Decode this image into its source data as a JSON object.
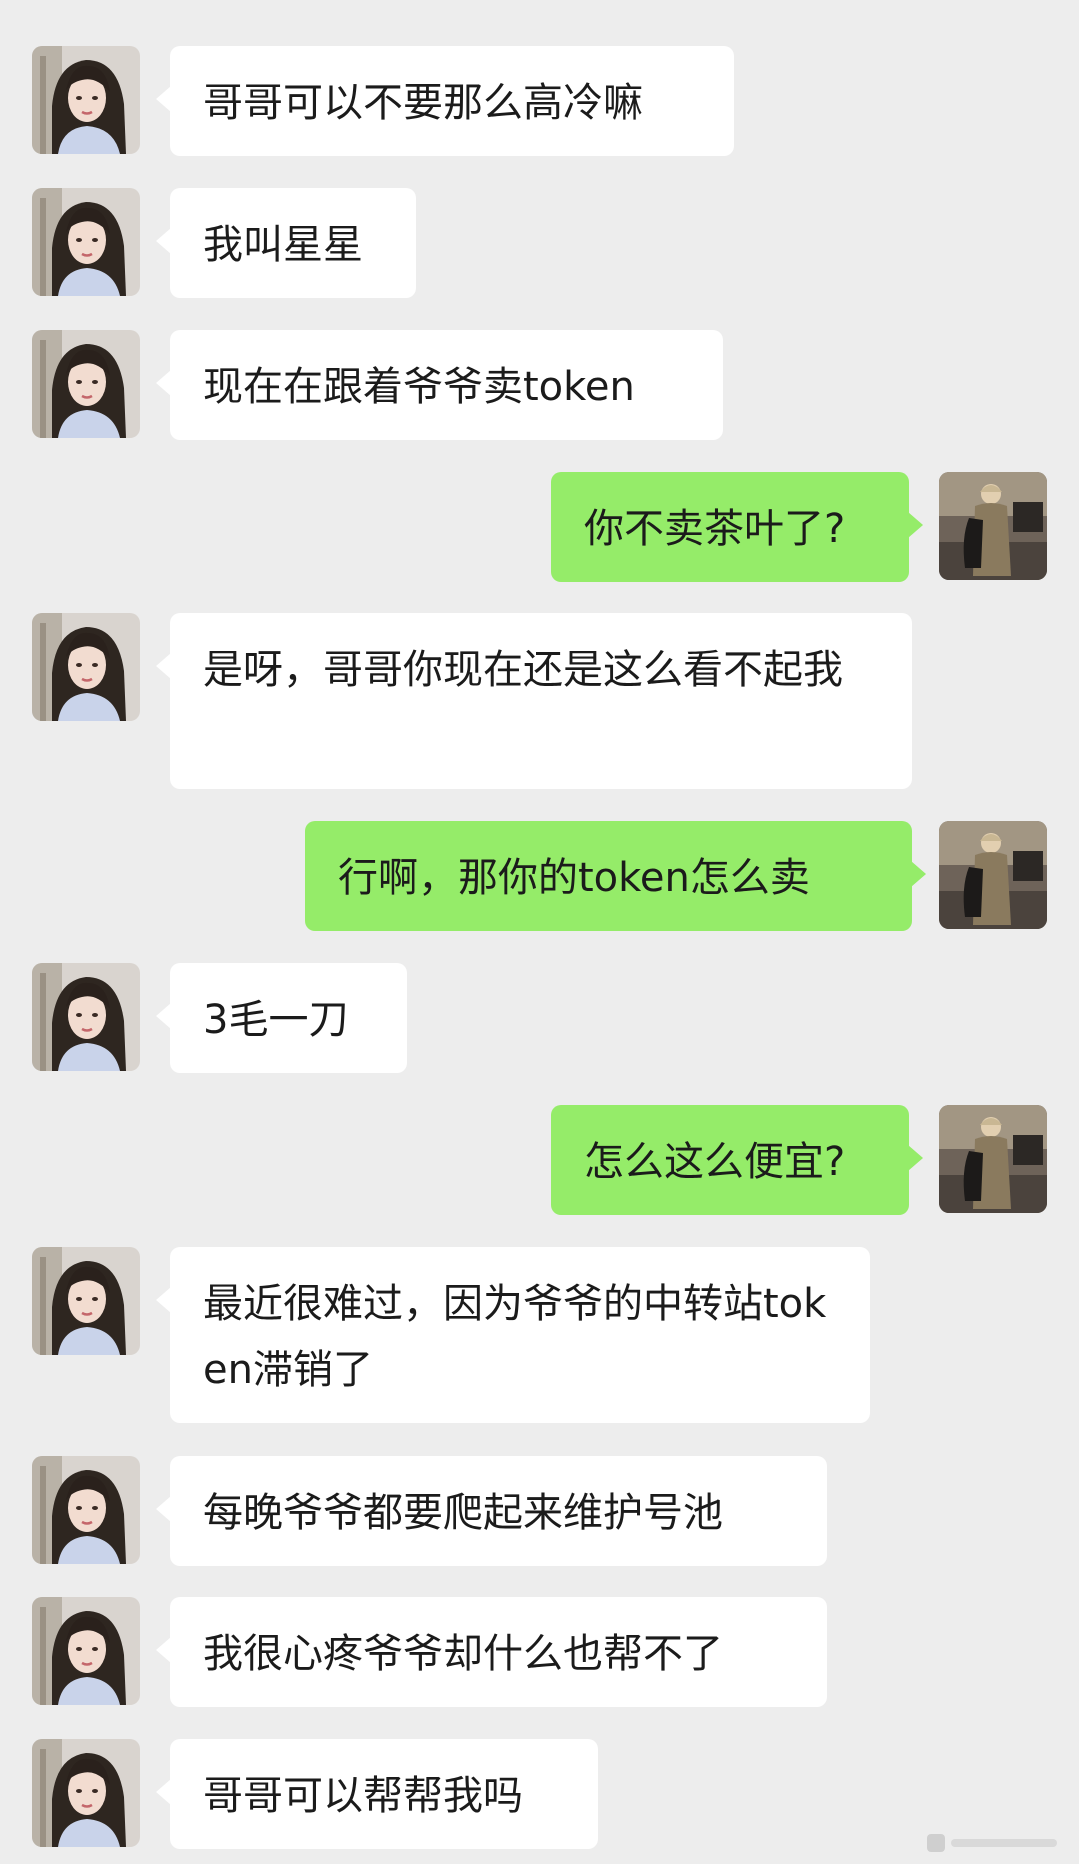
{
  "colors": {
    "background": "#ededed",
    "incoming_bubble": "#ffffff",
    "outgoing_bubble": "#95ec69",
    "text": "#1b1b1b"
  },
  "avatars": {
    "left_icon": "girl-avatar-icon",
    "right_icon": "man-photo-avatar-icon"
  },
  "messages": [
    {
      "side": "left",
      "text": "哥哥可以不要那么高冷嘛"
    },
    {
      "side": "left",
      "text": "我叫星星"
    },
    {
      "side": "left",
      "text": "现在在跟着爷爷卖token"
    },
    {
      "side": "right",
      "text": "你不卖茶叶了?"
    },
    {
      "side": "left",
      "text": "是呀，哥哥你现在还是这么看不起我"
    },
    {
      "side": "right",
      "text": "行啊，那你的token怎么卖"
    },
    {
      "side": "left",
      "text": "3毛一刀"
    },
    {
      "side": "right",
      "text": "怎么这么便宜?"
    },
    {
      "side": "left",
      "text": "最近很难过，因为爷爷的中转站token滞销了"
    },
    {
      "side": "left",
      "text": "每晚爷爷都要爬起来维护号池"
    },
    {
      "side": "left",
      "text": "我很心疼爷爷却什么也帮不了"
    },
    {
      "side": "left",
      "text": "哥哥可以帮帮我吗"
    }
  ]
}
